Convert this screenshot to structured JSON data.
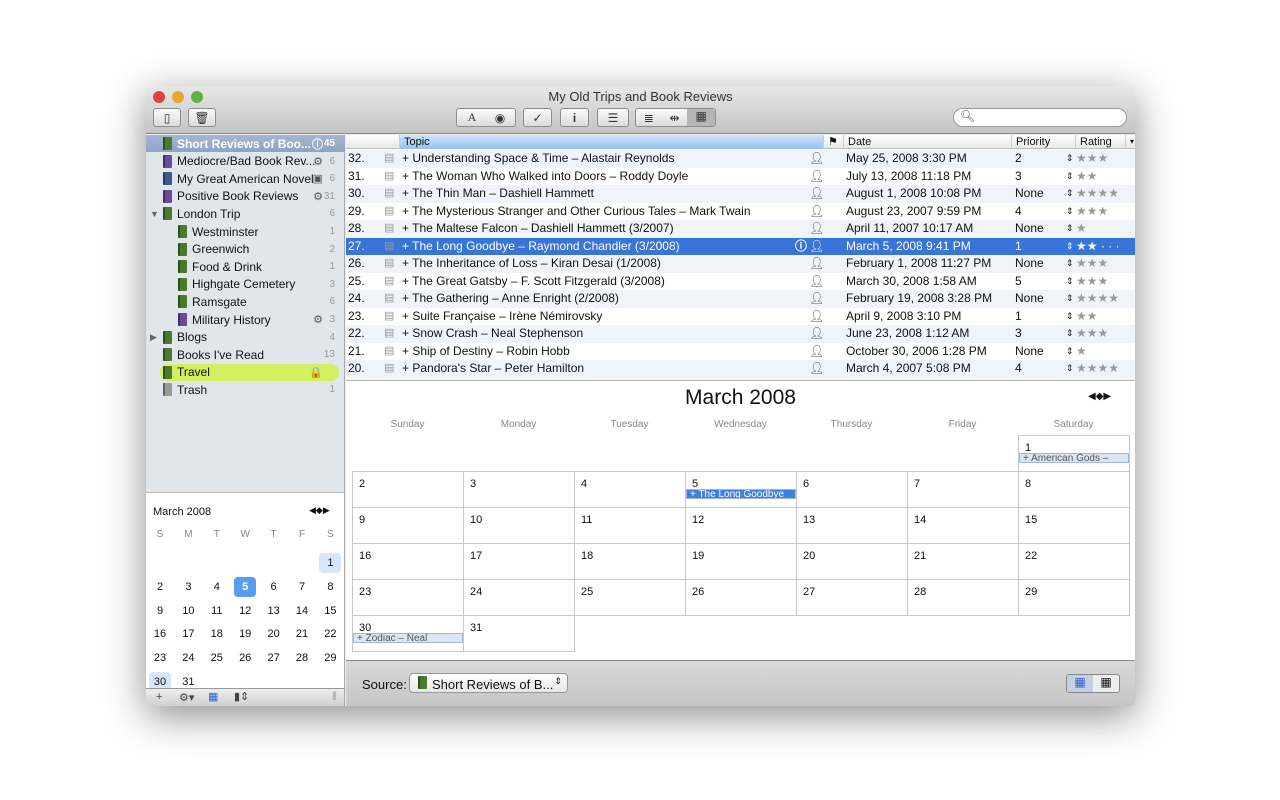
{
  "window": {
    "title": "My Old Trips and Book Reviews"
  },
  "toolbar": {
    "search_placeholder": "",
    "font_glyph": "A",
    "check_glyph": "✓",
    "info_glyph": "i"
  },
  "sidebar": {
    "items": [
      {
        "label": "Short Reviews of Boo...",
        "count": "45",
        "color": "#4a7a2c",
        "indent": 0,
        "badge": "ⓘ",
        "selected": true
      },
      {
        "label": "Mediocre/Bad Book Rev...",
        "count": "6",
        "color": "#6a4a9a",
        "indent": 0,
        "badge": "⚙"
      },
      {
        "label": "My Great American Novel",
        "count": "6",
        "color": "#3c5a8a",
        "indent": 0,
        "badge": "▣"
      },
      {
        "label": "Positive Book Reviews",
        "count": "31",
        "color": "#6a4a9a",
        "indent": 0,
        "badge": "⚙"
      },
      {
        "label": "London Trip",
        "count": "6",
        "color": "#4a7a2c",
        "indent": 0,
        "arrow": "▼"
      },
      {
        "label": "Westminster",
        "count": "1",
        "color": "#4a7a2c",
        "indent": 1
      },
      {
        "label": "Greenwich",
        "count": "2",
        "color": "#4a7a2c",
        "indent": 1
      },
      {
        "label": "Food & Drink",
        "count": "1",
        "color": "#4a7a2c",
        "indent": 1
      },
      {
        "label": "Highgate Cemetery",
        "count": "3",
        "color": "#4a7a2c",
        "indent": 1
      },
      {
        "label": "Ramsgate",
        "count": "6",
        "color": "#4a7a2c",
        "indent": 1
      },
      {
        "label": "Military History",
        "count": "3",
        "color": "#6a4a9a",
        "indent": 1,
        "badge": "⚙"
      },
      {
        "label": "Blogs",
        "count": "4",
        "color": "#4a7a2c",
        "indent": 0,
        "arrow": "▶"
      },
      {
        "label": "Books I've Read",
        "count": "13",
        "color": "#4a7a2c",
        "indent": 0
      },
      {
        "label": "Travel",
        "count": "",
        "color": "#4a7a2c",
        "indent": 0,
        "badge": "🔒",
        "highlight": true
      },
      {
        "label": "Trash",
        "count": "1",
        "color": "#999999",
        "indent": 0
      }
    ]
  },
  "mini_calendar": {
    "title": "March 2008",
    "weekdays": [
      "S",
      "M",
      "T",
      "W",
      "T",
      "F",
      "S"
    ],
    "first_weekday": 6,
    "days": 31,
    "selected": 5,
    "marked": [
      1,
      30
    ]
  },
  "table": {
    "columns": {
      "topic": "Topic",
      "date": "Date",
      "priority": "Priority",
      "rating": "Rating"
    },
    "rows": [
      {
        "num": "32.",
        "topic": "+ Understanding Space & Time – Alastair Reynolds",
        "date": "May 25, 2008 3:30 PM",
        "priority": "2",
        "rating": 3
      },
      {
        "num": "31.",
        "topic": "+ The Woman Who Walked into Doors – Roddy Doyle",
        "date": "July 13, 2008 11:18 PM",
        "priority": "3",
        "rating": 2
      },
      {
        "num": "30.",
        "topic": "+ The Thin Man – Dashiell Hammett",
        "date": "August 1, 2008 10:08 PM",
        "priority": "None",
        "rating": 4
      },
      {
        "num": "29.",
        "topic": "+ The Mysterious Stranger and Other Curious Tales – Mark Twain",
        "date": "August 23, 2007 9:59 PM",
        "priority": "4",
        "rating": 3
      },
      {
        "num": "28.",
        "topic": "+ The Maltese Falcon – Dashiell Hammett (3/2007)",
        "date": "April 11, 2007 10:17 AM",
        "priority": "None",
        "rating": 1
      },
      {
        "num": "27.",
        "topic": "+ The Long Goodbye – Raymond Chandler (3/2008)",
        "date": "March 5, 2008 9:41 PM",
        "priority": "1",
        "rating": 2,
        "selected": true
      },
      {
        "num": "26.",
        "topic": "+ The Inheritance of Loss – Kiran Desai  (1/2008)",
        "date": "February 1, 2008 11:27 PM",
        "priority": "None",
        "rating": 3
      },
      {
        "num": "25.",
        "topic": "+ The Great Gatsby – F. Scott Fitzgerald (3/2008)",
        "date": "March 30, 2008 1:58 AM",
        "priority": "5",
        "rating": 3
      },
      {
        "num": "24.",
        "topic": "+ The Gathering – Anne Enright (2/2008)",
        "date": "February 19, 2008 3:28 PM",
        "priority": "None",
        "rating": 4
      },
      {
        "num": "23.",
        "topic": "+ Suite Française – Irène Némirovsky",
        "date": "April 9, 2008 3:10 PM",
        "priority": "1",
        "rating": 2
      },
      {
        "num": "22.",
        "topic": "+ Snow Crash – Neal Stephenson",
        "date": "June 23, 2008 1:12 AM",
        "priority": "3",
        "rating": 3
      },
      {
        "num": "21.",
        "topic": "+ Ship of Destiny – Robin Hobb",
        "date": "October 30, 2006 1:28 PM",
        "priority": "None",
        "rating": 1
      },
      {
        "num": "20.",
        "topic": "+ Pandora's Star – Peter Hamilton",
        "date": "March 4, 2007 5:08 PM",
        "priority": "4",
        "rating": 4
      }
    ]
  },
  "calendar": {
    "title": "March 2008",
    "weekdays": [
      "Sunday",
      "Monday",
      "Tuesday",
      "Wednesday",
      "Thursday",
      "Friday",
      "Saturday"
    ],
    "first_weekday": 6,
    "days": 31,
    "events": [
      {
        "day": 1,
        "label": "+ American Gods –"
      },
      {
        "day": 5,
        "label": "+ The Long Goodbye",
        "selected": true
      },
      {
        "day": 30,
        "label": "+ Zodiac – Neal"
      }
    ]
  },
  "bottom": {
    "source_label": "Source:",
    "source_value": "Short Reviews of B..."
  }
}
